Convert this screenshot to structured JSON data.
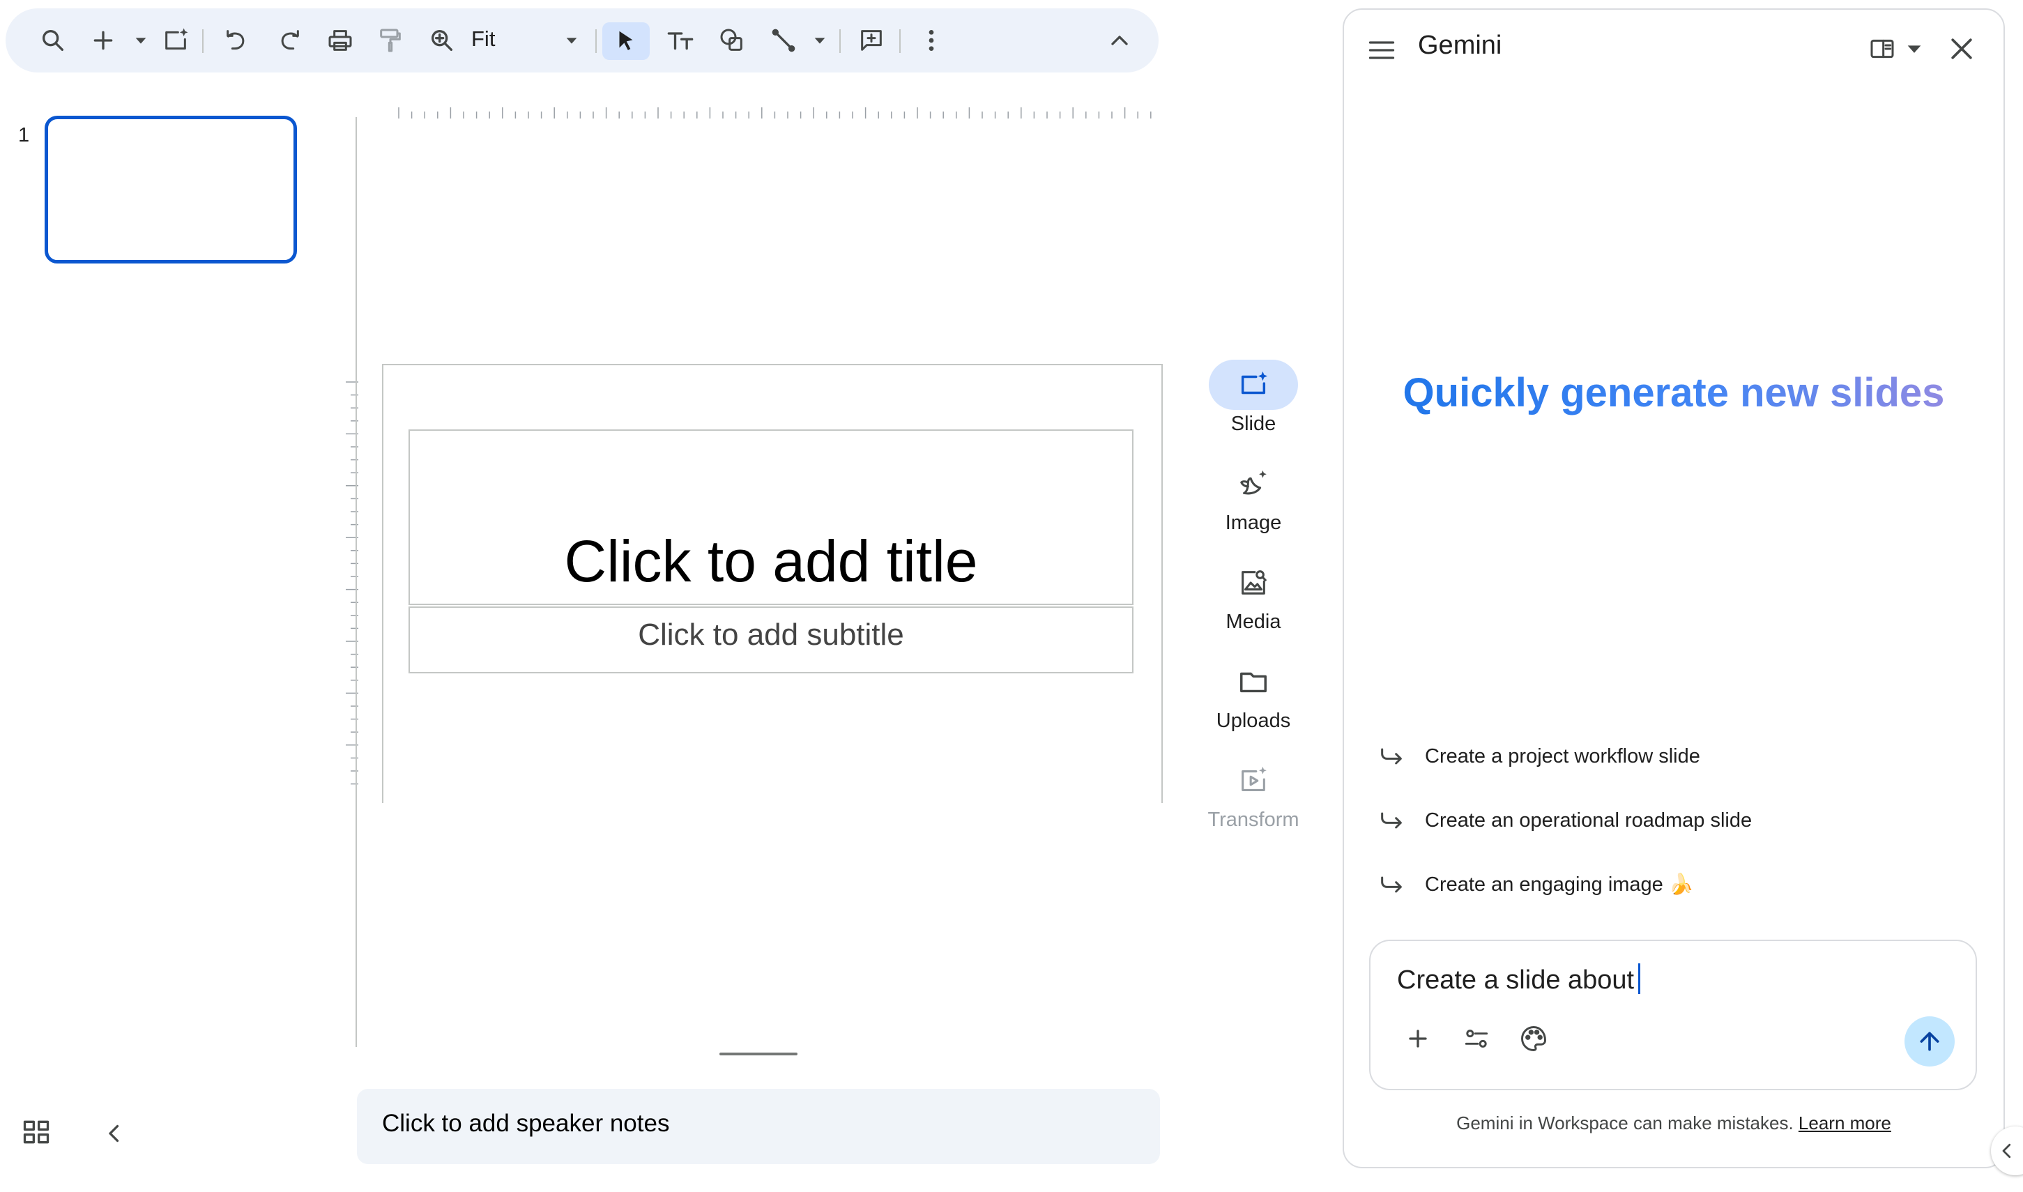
{
  "toolbar": {
    "zoom": "Fit"
  },
  "filmstrip": {
    "slide_number": "1"
  },
  "slide": {
    "title_placeholder": "Click to add title",
    "subtitle_placeholder": "Click to add subtitle"
  },
  "notes": {
    "placeholder": "Click to add speaker notes"
  },
  "rail": {
    "slide": "Slide",
    "image": "Image",
    "media": "Media",
    "uploads": "Uploads",
    "transform": "Transform"
  },
  "gemini": {
    "title": "Gemini",
    "hero": "Quickly generate new slides",
    "suggestions": [
      "Create a project workflow slide",
      "Create an operational roadmap slide",
      "Create an engaging image 🍌"
    ],
    "input_value": "Create a slide about",
    "disclaimer": "Gemini in Workspace can make mistakes.",
    "learn_more": "Learn more"
  },
  "colors": {
    "accent": "#0b57d0",
    "toolbar_bg": "#edf2fa",
    "send_button": "#c2e7ff",
    "hero_gradient": [
      "#1a73e8",
      "#a38bde"
    ]
  }
}
